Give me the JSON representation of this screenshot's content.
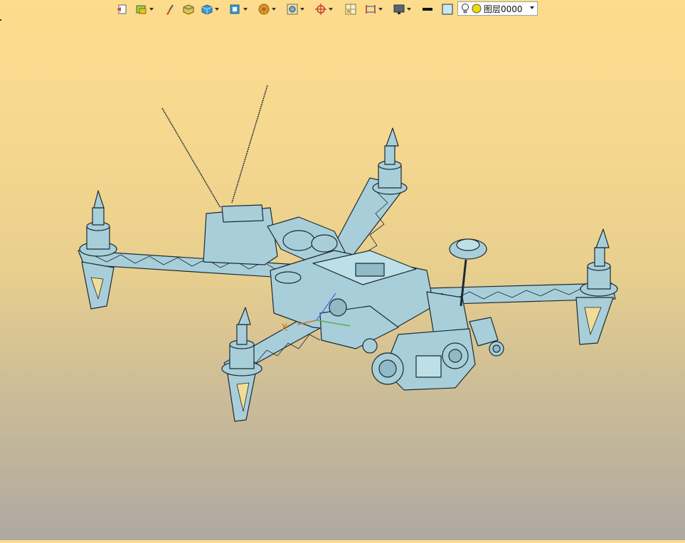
{
  "toolbar": {
    "buttons": [
      {
        "name": "exit-sketch-icon",
        "dropdown": false
      },
      {
        "name": "view-style-icon",
        "dropdown": true
      },
      {
        "name": "paint-brush-icon",
        "dropdown": false
      },
      {
        "name": "shaded-box-icon",
        "dropdown": false
      },
      {
        "name": "solid-cube-icon",
        "dropdown": true
      },
      {
        "name": "view-orient-icon",
        "dropdown": true
      },
      {
        "name": "render-sphere-icon",
        "dropdown": true
      },
      {
        "name": "zoom-fit-icon",
        "dropdown": true
      },
      {
        "name": "crosshair-snap-icon",
        "dropdown": true
      },
      {
        "name": "grid-icon",
        "dropdown": false
      },
      {
        "name": "dimension-icon",
        "dropdown": true
      },
      {
        "name": "display-monitor-icon",
        "dropdown": true
      },
      {
        "name": "line-weight-icon",
        "dropdown": false
      },
      {
        "name": "color-swatch-icon",
        "dropdown": false
      },
      {
        "name": "layer-stack-icon",
        "dropdown": true
      }
    ]
  },
  "layer_selector": {
    "label": "图层0000",
    "colors": {
      "bulb": "#ffffff",
      "layer_dot": "#e8e000"
    }
  },
  "viewport": {
    "axis_label": "X",
    "model_color": "#a8cfd9",
    "outline_color": "#1c2a33"
  }
}
